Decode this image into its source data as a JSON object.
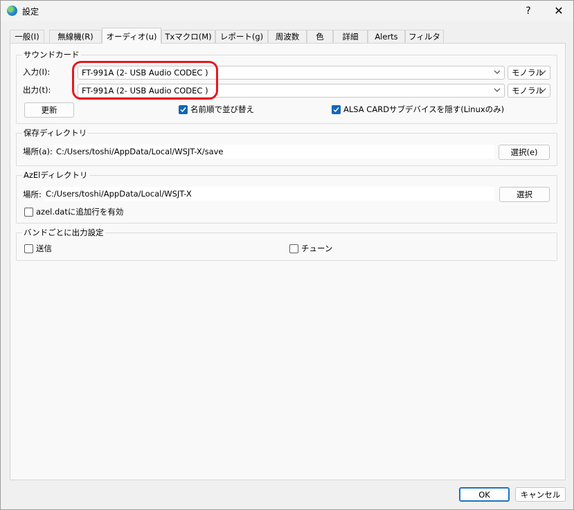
{
  "window": {
    "title": "設定",
    "help": "?",
    "close": "✕"
  },
  "tabs": [
    {
      "label": "一般(I)"
    },
    {
      "label": "無線機(R)"
    },
    {
      "label": "オーディオ(u)"
    },
    {
      "label": "Txマクロ(M)"
    },
    {
      "label": "レポート(g)"
    },
    {
      "label": "周波数"
    },
    {
      "label": "色"
    },
    {
      "label": "詳細"
    },
    {
      "label": "Alerts"
    },
    {
      "label": "フィルタ"
    }
  ],
  "soundcard": {
    "legend": "サウンドカード",
    "input_label": "入力(I):",
    "input_device": "FT-991A (2- USB Audio CODEC )",
    "input_channel": "モノラル",
    "output_label": "出力(t):",
    "output_device": "FT-991A (2- USB Audio CODEC )",
    "output_channel": "モノラル",
    "refresh_button": "更新",
    "sort_by_name": "名前順で並び替え",
    "hide_alsa": "ALSA CARDサブデバイスを隠す(Linuxのみ)"
  },
  "save_dir": {
    "legend": "保存ディレクトリ",
    "path_label": "場所(a):",
    "path": "C:/Users/toshi/AppData/Local/WSJT-X/save",
    "select_button": "選択(e)"
  },
  "azel_dir": {
    "legend": "AzElディレクトリ",
    "path_label": "場所:",
    "path": "C:/Users/toshi/AppData/Local/WSJT-X",
    "select_button": "選択",
    "append_label": "azel.datに追加行を有効"
  },
  "band_output": {
    "legend": "バンドごとに出力設定",
    "transmit_label": "送信",
    "tune_label": "チューン"
  },
  "footer": {
    "ok": "OK",
    "cancel": "キャンセル"
  },
  "colors": {
    "accent": "#1466b8",
    "annotation": "#e8171c"
  }
}
